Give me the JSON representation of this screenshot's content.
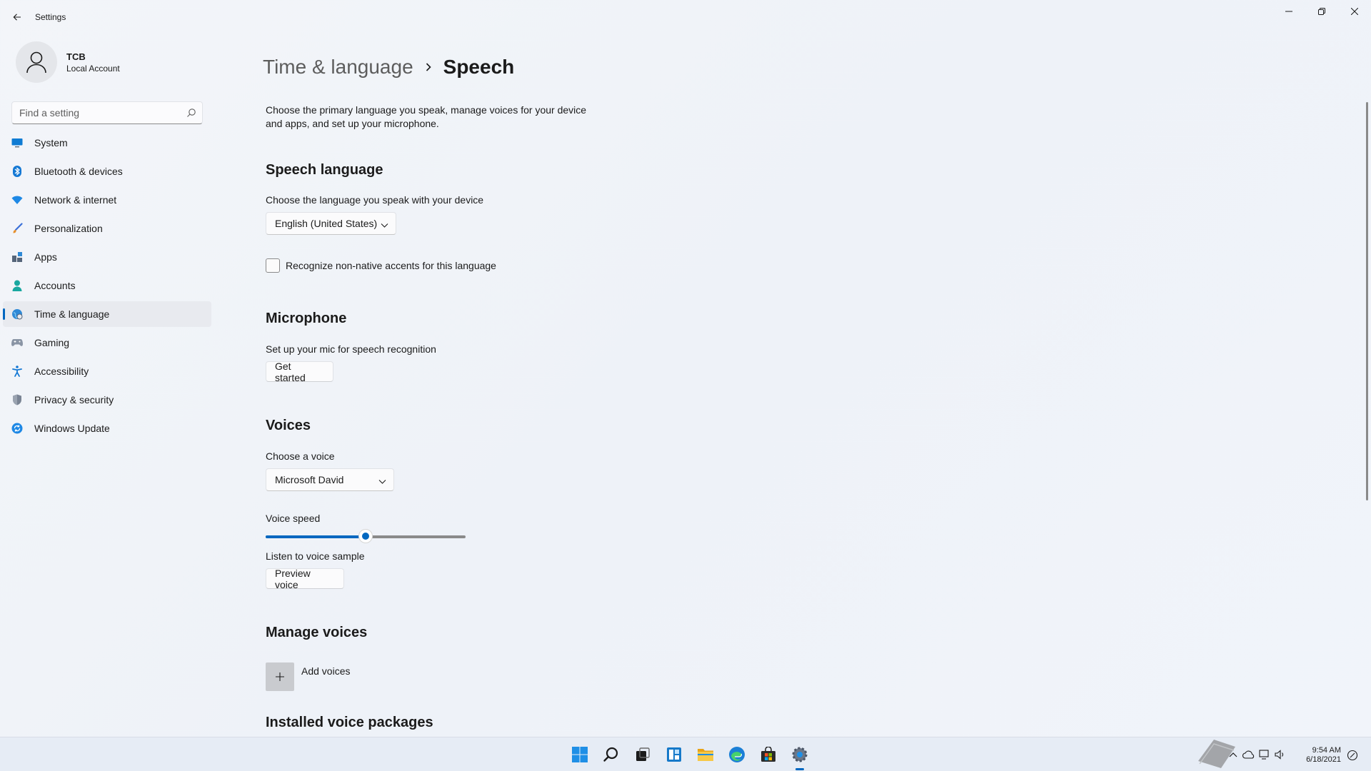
{
  "window": {
    "title": "Settings"
  },
  "profile": {
    "name": "TCB",
    "account_type": "Local Account"
  },
  "search": {
    "placeholder": "Find a setting"
  },
  "sidebar": {
    "items": [
      {
        "label": "System",
        "icon": "monitor-icon",
        "active": false
      },
      {
        "label": "Bluetooth & devices",
        "icon": "bluetooth-icon",
        "active": false
      },
      {
        "label": "Network & internet",
        "icon": "wifi-icon",
        "active": false
      },
      {
        "label": "Personalization",
        "icon": "brush-icon",
        "active": false
      },
      {
        "label": "Apps",
        "icon": "apps-icon",
        "active": false
      },
      {
        "label": "Accounts",
        "icon": "person-icon",
        "active": false
      },
      {
        "label": "Time & language",
        "icon": "globe-clock-icon",
        "active": true
      },
      {
        "label": "Gaming",
        "icon": "gamepad-icon",
        "active": false
      },
      {
        "label": "Accessibility",
        "icon": "accessibility-icon",
        "active": false
      },
      {
        "label": "Privacy & security",
        "icon": "shield-icon",
        "active": false
      },
      {
        "label": "Windows Update",
        "icon": "update-icon",
        "active": false
      }
    ]
  },
  "breadcrumb": {
    "parent": "Time & language",
    "current": "Speech"
  },
  "main": {
    "description": "Choose the primary language you speak, manage voices for your device and apps, and set up your microphone.",
    "speech_language": {
      "title": "Speech language",
      "label": "Choose the language you speak with your device",
      "selected": "English (United States)",
      "checkbox_label": "Recognize non-native accents for this language",
      "checkbox_checked": false
    },
    "microphone": {
      "title": "Microphone",
      "label": "Set up your mic for speech recognition",
      "button": "Get started"
    },
    "voices": {
      "title": "Voices",
      "choose_label": "Choose a voice",
      "selected_voice": "Microsoft David",
      "speed_label": "Voice speed",
      "speed_fraction": 0.5,
      "sample_label": "Listen to voice sample",
      "preview_button": "Preview voice"
    },
    "manage_voices": {
      "title": "Manage voices",
      "add_label": "Add voices"
    },
    "installed": {
      "title": "Installed voice packages"
    }
  },
  "taskbar": {
    "apps": [
      "windows-start-icon",
      "search-icon",
      "task-view-icon",
      "widgets-icon",
      "file-explorer-icon",
      "edge-icon",
      "store-icon",
      "settings-icon"
    ],
    "active_app": "settings-icon"
  },
  "tray": {
    "time": "9:54 AM",
    "date": "6/18/2021"
  },
  "colors": {
    "accent": "#0067c0",
    "background": "#f3f5f9"
  }
}
